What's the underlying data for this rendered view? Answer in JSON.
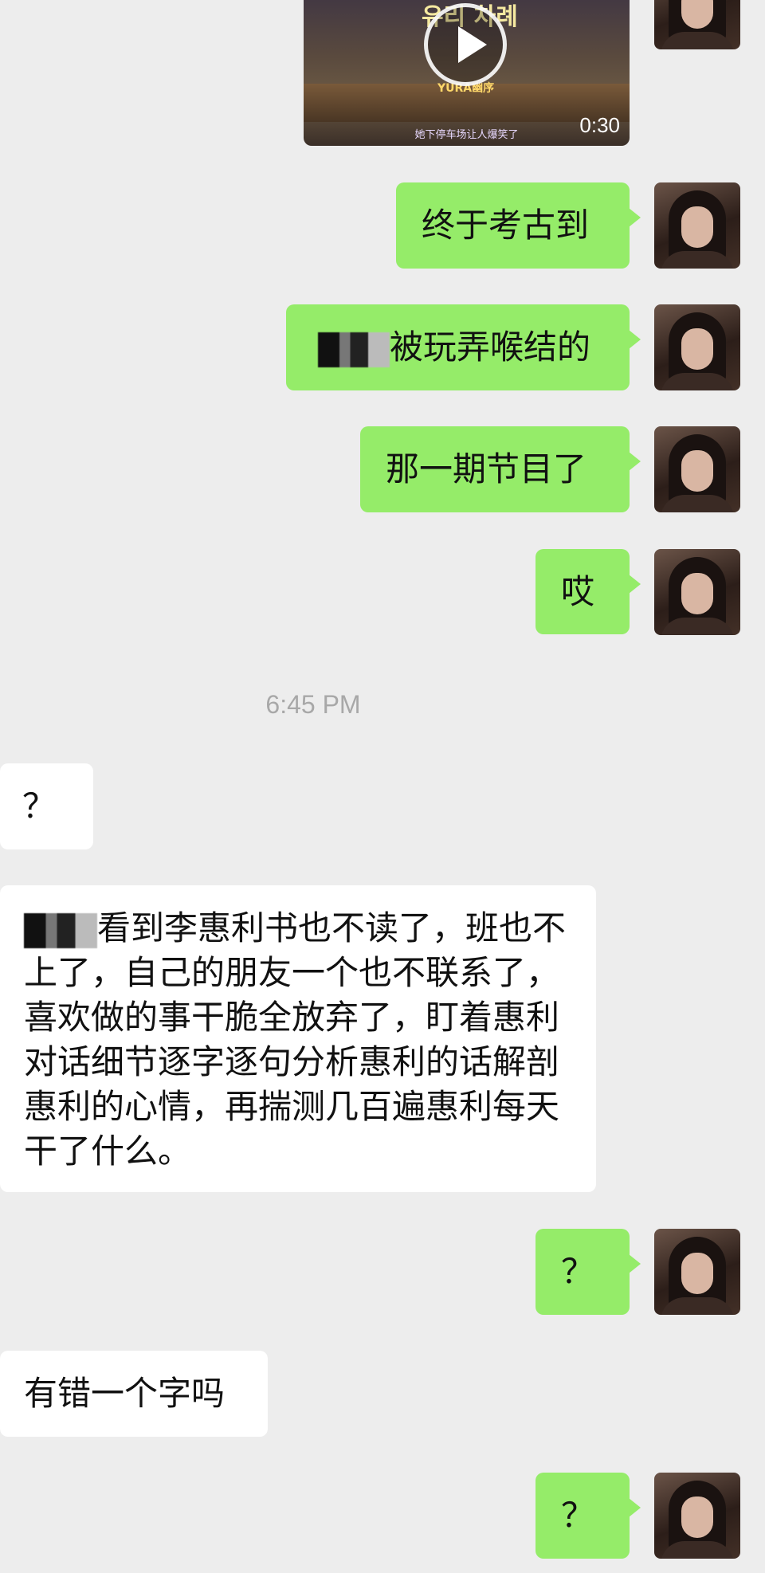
{
  "video": {
    "duration": "0:30",
    "caption": "她下停车场让人爆笑了",
    "logo_text": "유리 차례",
    "brand": "YURA幽序"
  },
  "messages": [
    {
      "side": "me",
      "text": "终于考古到"
    },
    {
      "side": "me",
      "text": "被玩弄喉结的"
    },
    {
      "side": "me",
      "text": "那一期节目了"
    },
    {
      "side": "me",
      "text": "哎"
    },
    {
      "side": "them",
      "text": "？"
    },
    {
      "side": "them",
      "text": "看到李惠利书也不读了，班也不上了，自己的朋友一个也不联系了，喜欢做的事干脆全放弃了，盯着惠利对话细节逐字逐句分析惠利的话解剖惠利的心情，再揣测几百遍惠利每天干了什么。"
    },
    {
      "side": "me",
      "text": "？"
    },
    {
      "side": "them",
      "text": "有错一个字吗"
    },
    {
      "side": "me",
      "text": "？"
    }
  ],
  "timestamp": "6:45 PM",
  "colors": {
    "background": "#ededed",
    "my_bubble": "#95ec69",
    "their_bubble": "#ffffff"
  }
}
